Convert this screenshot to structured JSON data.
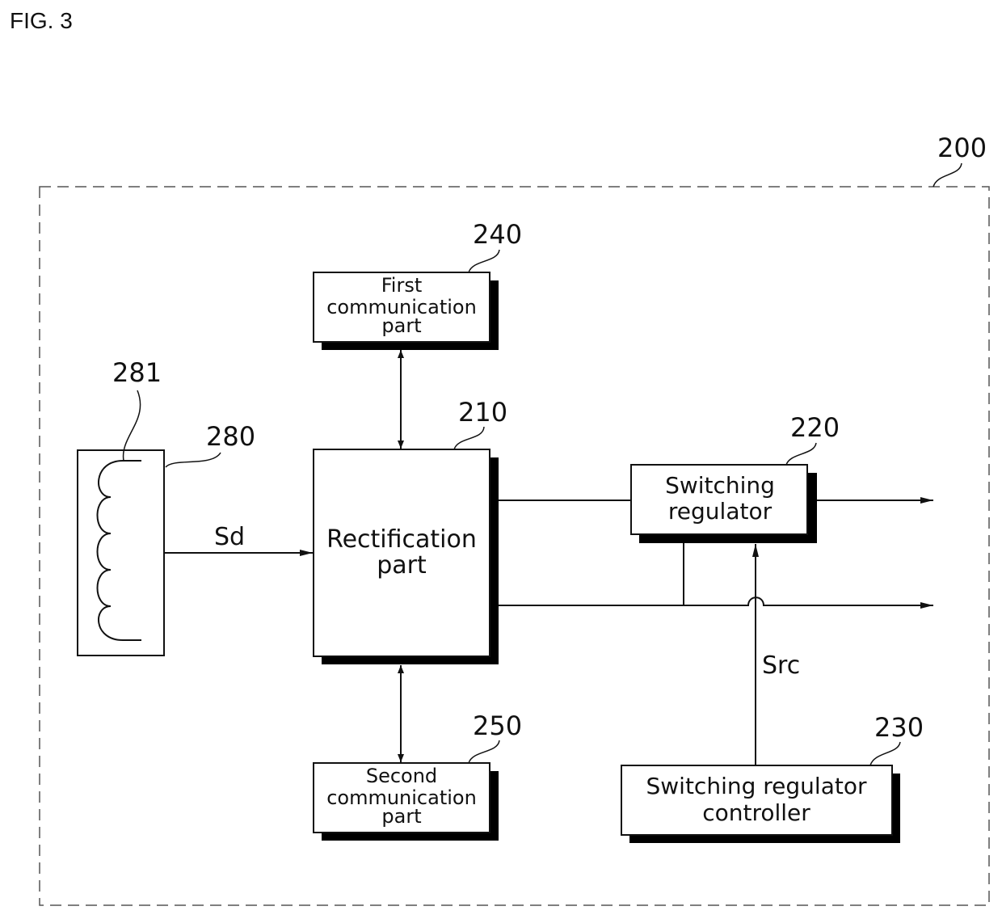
{
  "figure": {
    "title": "FIG. 3"
  },
  "system": {
    "ref": "200"
  },
  "coil_block": {
    "ref": "280",
    "coil_ref": "281"
  },
  "blocks": {
    "rectification": {
      "ref": "210",
      "lines": [
        "Rectification",
        "part"
      ]
    },
    "switching_regulator": {
      "ref": "220",
      "lines": [
        "Switching",
        "regulator"
      ]
    },
    "regulator_controller": {
      "ref": "230",
      "lines": [
        "Switching regulator",
        "controller"
      ]
    },
    "first_comm": {
      "ref": "240",
      "lines": [
        "First",
        "communication",
        "part"
      ]
    },
    "second_comm": {
      "ref": "250",
      "lines": [
        "Second",
        "communication",
        "part"
      ]
    }
  },
  "signals": {
    "sd": "Sd",
    "src": "Src"
  },
  "colors": {
    "stroke": "#111111",
    "shadow": "#000000",
    "border_dash": "#555555"
  }
}
